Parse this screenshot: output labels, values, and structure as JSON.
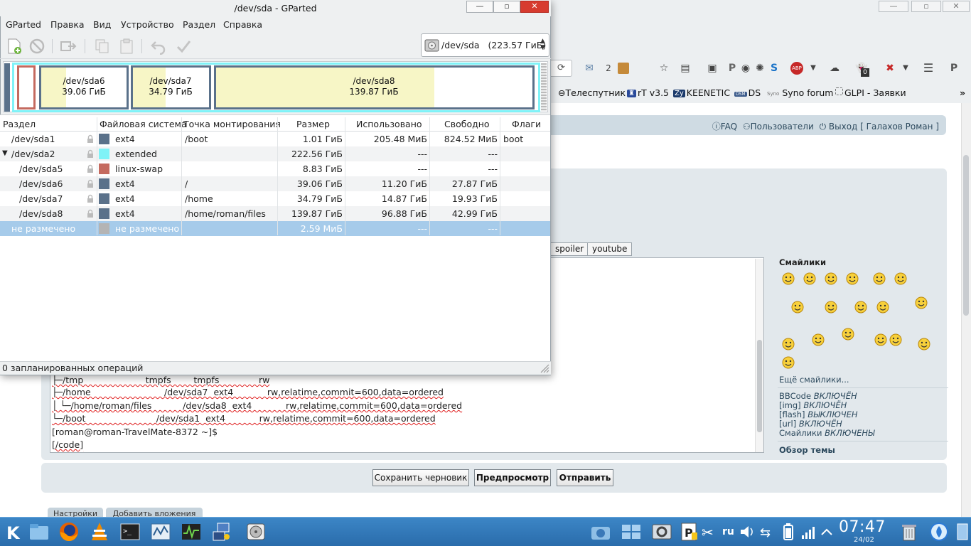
{
  "gparted": {
    "title": "/dev/sda - GParted",
    "menu": [
      "GParted",
      "Правка",
      "Вид",
      "Устройство",
      "Раздел",
      "Справка"
    ],
    "device_selector": "/dev/sda   (223.57 ГиБ)",
    "map": [
      {
        "name": "/dev/sda6",
        "size": "39.06 ГиБ",
        "used_fraction": 0.29
      },
      {
        "name": "/dev/sda7",
        "size": "34.79 ГиБ",
        "used_fraction": 0.43
      },
      {
        "name": "/dev/sda8",
        "size": "139.87 ГиБ",
        "used_fraction": 0.69
      }
    ],
    "columns": [
      "Раздел",
      "Файловая система",
      "Точка монтирования",
      "Размер",
      "Использовано",
      "Свободно",
      "Флаги"
    ],
    "rows": [
      {
        "name": "/dev/sda1",
        "fs": "ext4",
        "mount": "/boot",
        "size": "1.01 ГиБ",
        "used": "205.48 МиБ",
        "free": "824.52 МиБ",
        "flags": "boot",
        "color": "#5a718a"
      },
      {
        "name": "/dev/sda2",
        "fs": "extended",
        "mount": "",
        "size": "222.56 ГиБ",
        "used": "---",
        "free": "---",
        "flags": "",
        "color": "#7ff2f7"
      },
      {
        "name": "/dev/sda5",
        "fs": "linux-swap",
        "mount": "",
        "size": "8.83 ГиБ",
        "used": "---",
        "free": "---",
        "flags": "",
        "color": "#c46a5f"
      },
      {
        "name": "/dev/sda6",
        "fs": "ext4",
        "mount": "/",
        "size": "39.06 ГиБ",
        "used": "11.20 ГиБ",
        "free": "27.87 ГиБ",
        "flags": "",
        "color": "#5a718a"
      },
      {
        "name": "/dev/sda7",
        "fs": "ext4",
        "mount": "/home",
        "size": "34.79 ГиБ",
        "used": "14.87 ГиБ",
        "free": "19.93 ГиБ",
        "flags": "",
        "color": "#5a718a"
      },
      {
        "name": "/dev/sda8",
        "fs": "ext4",
        "mount": "/home/roman/files",
        "size": "139.87 ГиБ",
        "used": "96.88 ГиБ",
        "free": "42.99 ГиБ",
        "flags": "",
        "color": "#5a718a"
      },
      {
        "name": "не размечено",
        "fs": "не размечено",
        "mount": "",
        "size": "2.59 МиБ",
        "used": "---",
        "free": "---",
        "flags": "",
        "color": "#b4b4b4"
      }
    ],
    "status": "0 запланированных операций"
  },
  "browser": {
    "nav_count": "2",
    "notify_count": "0",
    "bookmarks": [
      "Телеспутник",
      "rT v3.5",
      "KEENETIC",
      "DS",
      "Syno forum",
      "GLPI - Заявки"
    ],
    "bookmark_tags": {
      "keenetic": "Zy",
      "ds": "DSM",
      "syno": "Syno"
    },
    "forum_links": {
      "faq": "FAQ",
      "users": "Пользователи",
      "logout": "Выход [ Галахов Роман ]"
    },
    "bbcode_buttons": [
      "spoiler",
      "youtube"
    ],
    "code_lines": [
      "├─/tmp                      tmpfs        tmpfs              rw",
      "├─/home                          /dev/sda7  ext4            rw,relatime,commit=600,data=ordered",
      "│ └─/home/roman/files           /dev/sda8  ext4            rw,relatime,commit=600,data=ordered",
      "└─/boot                         /dev/sda1  ext4            rw,relatime,commit=600,data=ordered",
      "[roman@roman-TravelMate-8372 ~]$",
      "[/code]"
    ],
    "smilies_title": "Смайлики",
    "more_smilies": "Ещё смайлики...",
    "bb_status": [
      {
        "label": "BBCode",
        "value": "ВКЛЮЧЁН"
      },
      {
        "label": "[img]",
        "value": "ВКЛЮЧЁН"
      },
      {
        "label": "[flash]",
        "value": "ВЫКЛЮЧЕН"
      },
      {
        "label": "[url]",
        "value": "ВКЛЮЧЁН"
      },
      {
        "label": "Смайлики",
        "value": "ВКЛЮЧЕНЫ"
      }
    ],
    "review": "Обзор темы",
    "buttons": {
      "draft": "Сохранить черновик",
      "preview": "Предпросмотр",
      "submit": "Отправить"
    },
    "tabs": [
      "Настройки",
      "Добавить вложения"
    ]
  },
  "taskbar": {
    "keyboard": "ru",
    "time": "07:47",
    "date": "24/02"
  },
  "colors": {
    "taskbar": "#2f75b5",
    "selection": "#a6cbea",
    "ext4": "#5a718a",
    "extended": "#7ff2f7",
    "swap": "#c46a5f",
    "used_fill": "#f7f6c6"
  }
}
